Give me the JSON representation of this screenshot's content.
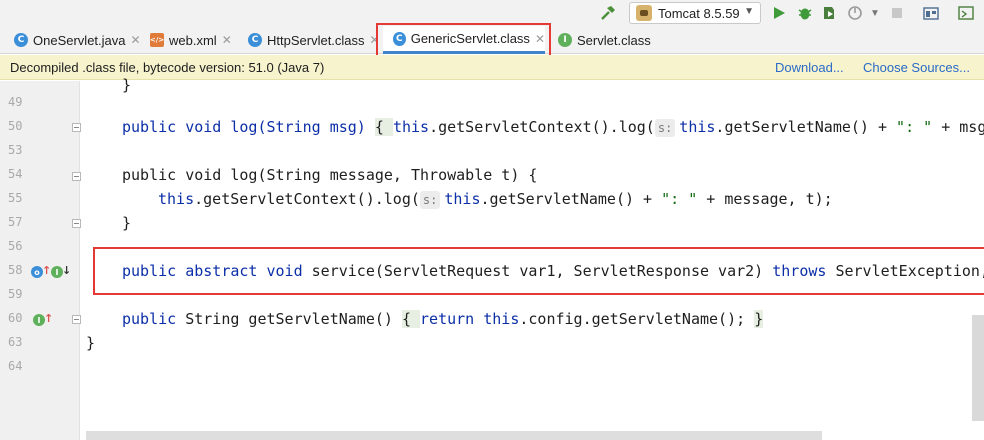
{
  "toolbar": {
    "run_config": "Tomcat 8.5.59",
    "icons": [
      "hammer-icon",
      "run-icon",
      "debug-icon",
      "coverage-icon",
      "profile-icon",
      "stop-icon",
      "frame-icon",
      "window-icon"
    ]
  },
  "tabs": [
    {
      "label": "OneServlet.java",
      "icon": "C",
      "active": false
    },
    {
      "label": "web.xml",
      "icon": "xml",
      "active": false
    },
    {
      "label": "HttpServlet.class",
      "icon": "C",
      "active": false
    },
    {
      "label": "GenericServlet.class",
      "icon": "C",
      "active": true
    },
    {
      "label": "Servlet.class",
      "icon": "I",
      "active": false
    }
  ],
  "banner": {
    "text": "Decompiled .class file, bytecode version: 51.0 (Java 7)",
    "download": "Download...",
    "choose_sources": "Choose Sources..."
  },
  "editor": {
    "line_numbers": [
      "49",
      "50",
      "53",
      "54",
      "55",
      "56",
      "57",
      "58",
      "59",
      "60",
      "63",
      "64"
    ],
    "hint_label": "s:",
    "code": {
      "l49": "}",
      "l50_a": "public void log(String msg) ",
      "l50_b": "{ ",
      "l50_c": "this",
      "l50_d": ".getServletContext().log(",
      "l50_e": "this",
      "l50_f": ".getServletName() + ",
      "l50_g": "\": \"",
      "l50_h": " + msg",
      "l54": "public void log(String message, Throwable t) {",
      "l55_a": "this",
      "l55_b": ".getServletContext().log(",
      "l55_c": "this",
      "l55_d": ".getServletName() + ",
      "l55_e": "\": \"",
      "l55_f": " + message, t);",
      "l56": "}",
      "l58_a": "public abstract void",
      "l58_b": " service(ServletRequest var1, ServletResponse var2) ",
      "l58_c": "throws",
      "l58_d": " ServletException,",
      "l60_a": "public",
      "l60_b": " String getServletName() ",
      "l60_c": "{ ",
      "l60_d": "return this",
      "l60_e": ".config.getServletName(); ",
      "l60_f": "}",
      "l63": "}"
    }
  },
  "colors": {
    "keyword": "#0c2fa8",
    "string": "#106b10",
    "highlight_box": "#e53935",
    "active_tab_underline": "#4083c9",
    "banner_bg": "#f6f3cd"
  }
}
